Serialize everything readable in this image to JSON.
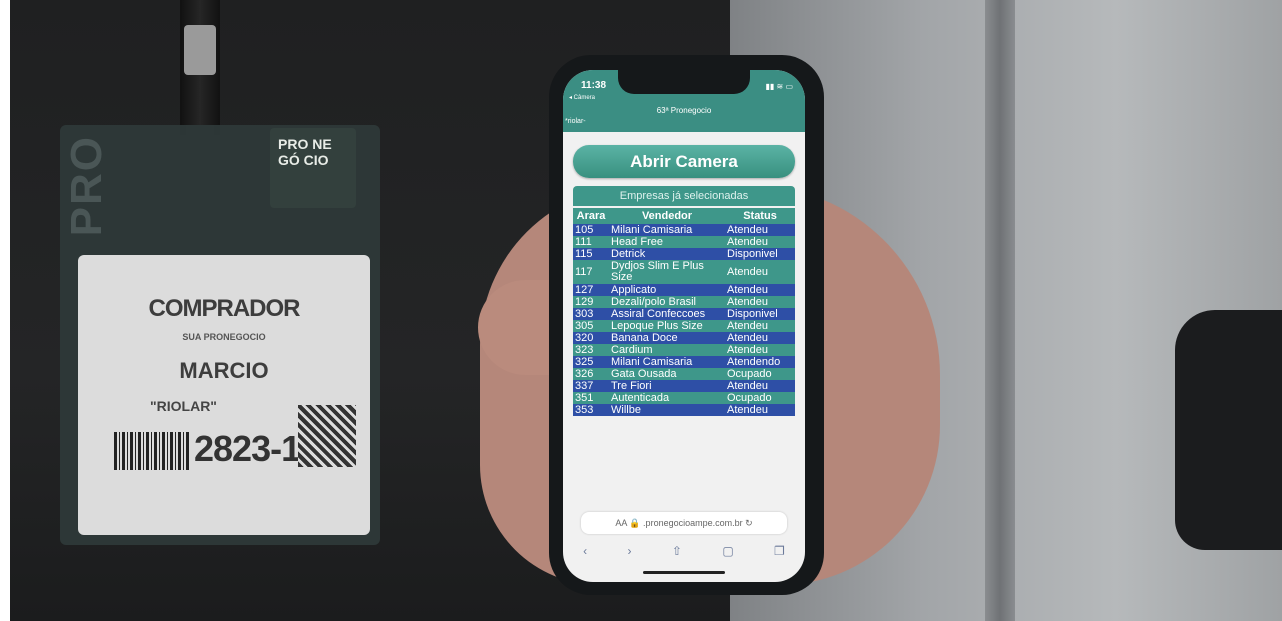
{
  "badge": {
    "role": "COMPRADOR",
    "event_line": "SUA PRONEGOCIO",
    "name": "MARCIO",
    "company": "\"RIOLAR\"",
    "code": "2823-1",
    "logo": "PRO NE GÓ CIO",
    "side_text": "PRO"
  },
  "phone": {
    "time": "11:38",
    "back_label": "◂ Câmera",
    "status_icons": "▮▮ ≋ ▭",
    "page_title": "63ª Pronegocio",
    "user_tag": "*riolar-",
    "open_camera_label": "Abrir Camera",
    "table_title": "Empresas já selecionadas",
    "columns": [
      "Arara",
      "Vendedor",
      "Status"
    ],
    "rows": [
      [
        "105",
        "Milani Camisaria",
        "Atendeu"
      ],
      [
        "111",
        "Head Free",
        "Atendeu"
      ],
      [
        "115",
        "Detrick",
        "Disponivel"
      ],
      [
        "117",
        "Dydjos Slim E Plus Size",
        "Atendeu"
      ],
      [
        "127",
        "Applicato",
        "Atendeu"
      ],
      [
        "129",
        "Dezali/polo Brasil",
        "Atendeu"
      ],
      [
        "303",
        "Assiral Confeccoes",
        "Disponivel"
      ],
      [
        "305",
        "Lepoque Plus Size",
        "Atendeu"
      ],
      [
        "320",
        "Banana Doce",
        "Atendeu"
      ],
      [
        "323",
        "Cardium",
        "Atendeu"
      ],
      [
        "325",
        "Milani Camisaria",
        "Atendendo"
      ],
      [
        "326",
        "Gata Ousada",
        "Ocupado"
      ],
      [
        "337",
        "Tre Fiori",
        "Atendeu"
      ],
      [
        "351",
        "Autenticada",
        "Ocupado"
      ],
      [
        "353",
        "Willbe",
        "Atendeu"
      ]
    ],
    "url_text": "AA  🔒 .pronegocioampe.com.br  ↻",
    "toolbar": [
      "‹",
      "›",
      "⇧",
      "▢",
      "❐"
    ]
  },
  "colors": {
    "teal": "#3e978a",
    "blue_row": "#2e4fa6"
  }
}
